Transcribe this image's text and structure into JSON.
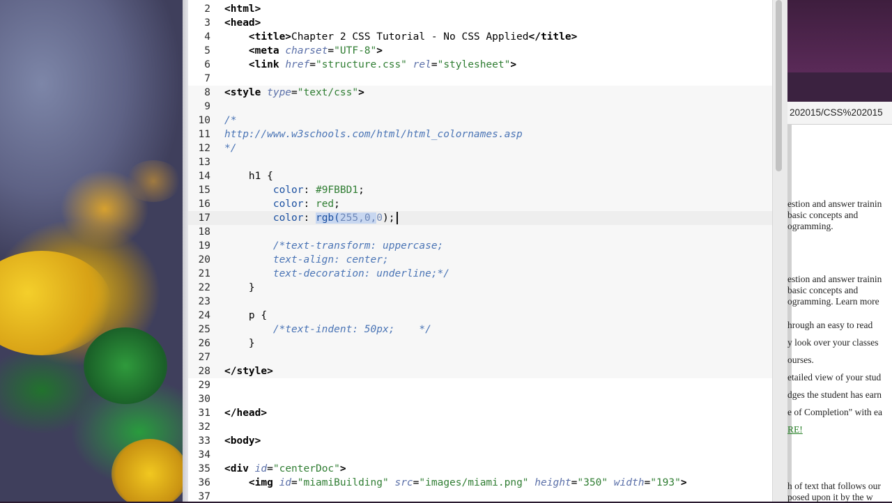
{
  "editor": {
    "lines": [
      {
        "n": "2",
        "tokens": [
          {
            "t": "<html>",
            "c": "tag"
          }
        ]
      },
      {
        "n": "3",
        "tokens": [
          {
            "t": "<head>",
            "c": "tag"
          }
        ]
      },
      {
        "n": "4",
        "tokens": [
          {
            "t": "    "
          },
          {
            "t": "<title>",
            "c": "tag"
          },
          {
            "t": "Chapter 2 CSS Tutorial - No CSS Applied",
            "c": "plain"
          },
          {
            "t": "</title>",
            "c": "tag"
          }
        ]
      },
      {
        "n": "5",
        "tokens": [
          {
            "t": "    "
          },
          {
            "t": "<meta ",
            "c": "tag"
          },
          {
            "t": "charset",
            "c": "attr"
          },
          {
            "t": "=",
            "c": "punct"
          },
          {
            "t": "\"UTF-8\"",
            "c": "str"
          },
          {
            "t": ">",
            "c": "tag"
          }
        ]
      },
      {
        "n": "6",
        "tokens": [
          {
            "t": "    "
          },
          {
            "t": "<link ",
            "c": "tag"
          },
          {
            "t": "href",
            "c": "attr"
          },
          {
            "t": "=",
            "c": "punct"
          },
          {
            "t": "\"structure.css\"",
            "c": "str"
          },
          {
            "t": " "
          },
          {
            "t": "rel",
            "c": "attr"
          },
          {
            "t": "=",
            "c": "punct"
          },
          {
            "t": "\"stylesheet\"",
            "c": "str"
          },
          {
            "t": ">",
            "c": "tag"
          }
        ]
      },
      {
        "n": "7",
        "tokens": []
      },
      {
        "n": "8",
        "style": true,
        "tokens": [
          {
            "t": "<style ",
            "c": "tag"
          },
          {
            "t": "type",
            "c": "attr"
          },
          {
            "t": "=",
            "c": "punct"
          },
          {
            "t": "\"text/css\"",
            "c": "str"
          },
          {
            "t": ">",
            "c": "tag"
          }
        ]
      },
      {
        "n": "9",
        "style": true,
        "tokens": []
      },
      {
        "n": "10",
        "style": true,
        "tokens": [
          {
            "t": "/*",
            "c": "cmt"
          }
        ]
      },
      {
        "n": "11",
        "style": true,
        "tokens": [
          {
            "t": "http://www.w3schools.com/html/html_colornames.asp",
            "c": "cmt"
          }
        ]
      },
      {
        "n": "12",
        "style": true,
        "tokens": [
          {
            "t": "*/",
            "c": "cmt"
          }
        ]
      },
      {
        "n": "13",
        "style": true,
        "tokens": []
      },
      {
        "n": "14",
        "style": true,
        "tokens": [
          {
            "t": "    "
          },
          {
            "t": "h1 {",
            "c": "sel"
          }
        ]
      },
      {
        "n": "15",
        "style": true,
        "tokens": [
          {
            "t": "        "
          },
          {
            "t": "color",
            "c": "prop"
          },
          {
            "t": ": ",
            "c": "punct"
          },
          {
            "t": "#9FBBD1",
            "c": "val"
          },
          {
            "t": ";",
            "c": "punct"
          }
        ]
      },
      {
        "n": "16",
        "style": true,
        "tokens": [
          {
            "t": "        "
          },
          {
            "t": "color",
            "c": "prop"
          },
          {
            "t": ": ",
            "c": "punct"
          },
          {
            "t": "red",
            "c": "val"
          },
          {
            "t": ";",
            "c": "punct"
          }
        ]
      },
      {
        "n": "17",
        "style": true,
        "current": true,
        "tokens": [
          {
            "t": "        "
          },
          {
            "t": "color",
            "c": "prop"
          },
          {
            "t": ": ",
            "c": "punct"
          },
          {
            "t": "rgb",
            "c": "fn"
          },
          {
            "t": "(",
            "c": "fn"
          },
          {
            "t": "255,0,",
            "c": "num"
          },
          {
            "t": "0",
            "c": "plainsel"
          },
          {
            "t": ");",
            "c": "punct"
          }
        ]
      },
      {
        "n": "18",
        "style": true,
        "tokens": []
      },
      {
        "n": "19",
        "style": true,
        "tokens": [
          {
            "t": "        "
          },
          {
            "t": "/*text-transform: uppercase;",
            "c": "cmt"
          }
        ]
      },
      {
        "n": "20",
        "style": true,
        "tokens": [
          {
            "t": "        "
          },
          {
            "t": "text-align: center;",
            "c": "cmt"
          }
        ]
      },
      {
        "n": "21",
        "style": true,
        "tokens": [
          {
            "t": "        "
          },
          {
            "t": "text-decoration: underline;*/",
            "c": "cmt"
          }
        ]
      },
      {
        "n": "22",
        "style": true,
        "tokens": [
          {
            "t": "    "
          },
          {
            "t": "}",
            "c": "sel"
          }
        ]
      },
      {
        "n": "23",
        "style": true,
        "tokens": []
      },
      {
        "n": "24",
        "style": true,
        "tokens": [
          {
            "t": "    "
          },
          {
            "t": "p {",
            "c": "sel"
          }
        ]
      },
      {
        "n": "25",
        "style": true,
        "tokens": [
          {
            "t": "        "
          },
          {
            "t": "/*text-indent: 50px;    */",
            "c": "cmt"
          }
        ]
      },
      {
        "n": "26",
        "style": true,
        "tokens": [
          {
            "t": "    "
          },
          {
            "t": "}",
            "c": "sel"
          }
        ]
      },
      {
        "n": "27",
        "style": true,
        "tokens": []
      },
      {
        "n": "28",
        "style": true,
        "tokens": [
          {
            "t": "</style>",
            "c": "tag"
          }
        ]
      },
      {
        "n": "29",
        "tokens": []
      },
      {
        "n": "30",
        "tokens": []
      },
      {
        "n": "31",
        "tokens": [
          {
            "t": "</head>",
            "c": "tag"
          }
        ]
      },
      {
        "n": "32",
        "tokens": []
      },
      {
        "n": "33",
        "tokens": [
          {
            "t": "<body>",
            "c": "tag"
          }
        ]
      },
      {
        "n": "34",
        "tokens": []
      },
      {
        "n": "35",
        "tokens": [
          {
            "t": "<div ",
            "c": "tag"
          },
          {
            "t": "id",
            "c": "attr"
          },
          {
            "t": "=",
            "c": "punct"
          },
          {
            "t": "\"centerDoc\"",
            "c": "str"
          },
          {
            "t": ">",
            "c": "tag"
          }
        ]
      },
      {
        "n": "36",
        "tokens": [
          {
            "t": "    "
          },
          {
            "t": "<img ",
            "c": "tag"
          },
          {
            "t": "id",
            "c": "attr"
          },
          {
            "t": "=",
            "c": "punct"
          },
          {
            "t": "\"miamiBuilding\"",
            "c": "str"
          },
          {
            "t": " "
          },
          {
            "t": "src",
            "c": "attr"
          },
          {
            "t": "=",
            "c": "punct"
          },
          {
            "t": "\"images/miami.png\"",
            "c": "str"
          },
          {
            "t": " "
          },
          {
            "t": "height",
            "c": "attr"
          },
          {
            "t": "=",
            "c": "punct"
          },
          {
            "t": "\"350\"",
            "c": "str"
          },
          {
            "t": " "
          },
          {
            "t": "width",
            "c": "attr"
          },
          {
            "t": "=",
            "c": "punct"
          },
          {
            "t": "\"193\"",
            "c": "str"
          },
          {
            "t": ">",
            "c": "tag"
          }
        ]
      },
      {
        "n": "37",
        "tokens": []
      }
    ]
  },
  "browser": {
    "url": "202015/CSS%202015",
    "page_lines": [
      {
        "text": "estion and answer trainin",
        "link": false
      },
      {
        "text": "basic concepts and",
        "link": false
      },
      {
        "text": "ogramming.",
        "link": false
      },
      {
        "text": "estion and answer trainin",
        "link": false
      },
      {
        "text": "basic concepts and",
        "link": false
      },
      {
        "text": "ogramming. Learn more",
        "link": false
      },
      {
        "text": "hrough an easy to read",
        "link": false
      },
      {
        "text": "y look over your classes",
        "link": false
      },
      {
        "text": "ourses.",
        "link": false
      },
      {
        "text": "etailed view of your stud",
        "link": false
      },
      {
        "text": "dges the student has earn",
        "link": false
      },
      {
        "text": "e of Completion\" with ea",
        "link": false
      },
      {
        "text": "RE!",
        "link": true
      },
      {
        "text": "h of text that follows our",
        "link": false
      },
      {
        "text": "posed upon it by the w",
        "link": false
      }
    ]
  }
}
